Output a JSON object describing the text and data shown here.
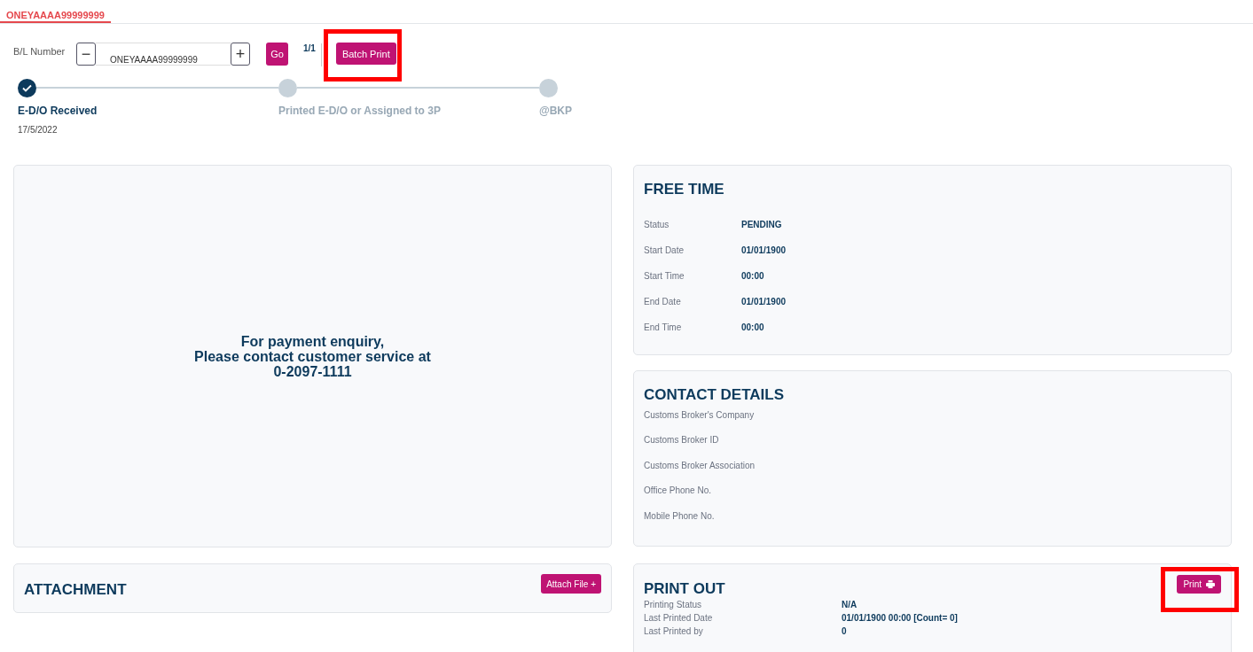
{
  "tabs": [
    {
      "label": "ONEYAAAA99999999",
      "selected": true
    }
  ],
  "search": {
    "label": "B/L Number",
    "minus": "−",
    "value": "ONEYAAAA99999999",
    "plus": "+",
    "go": "Go",
    "page": "1/1",
    "batch_print": "Batch Print",
    "highlighted": true
  },
  "steps": [
    {
      "label": "E-D/O Received",
      "date": "17/5/2022",
      "done": true
    },
    {
      "label": "Printed E-D/O or Assigned to 3P",
      "done": false
    },
    {
      "label": "@BKP",
      "done": false
    }
  ],
  "payment_notice": [
    "For payment enquiry,",
    "Please contact customer service at",
    "0-2097-1111"
  ],
  "free_time": {
    "title": "FREE TIME",
    "rows": [
      {
        "label": "Status",
        "value": "PENDING"
      },
      {
        "label": "Start Date",
        "value": "01/01/1900"
      },
      {
        "label": "Start Time",
        "value": "00:00"
      },
      {
        "label": "End Date",
        "value": "01/01/1900"
      },
      {
        "label": "End Time",
        "value": "00:00"
      }
    ]
  },
  "contact_details": {
    "title": "CONTACT DETAILS",
    "rows": [
      {
        "label": "Customs Broker's Company"
      },
      {
        "label": "Customs Broker ID"
      },
      {
        "label": "Customs Broker Association"
      },
      {
        "label": "Office Phone No."
      },
      {
        "label": "Mobile Phone No."
      }
    ]
  },
  "attachment": {
    "title": "ATTACHMENT",
    "button": "Attach File +"
  },
  "print_out": {
    "title": "PRINT OUT",
    "button": "Print",
    "highlighted": true,
    "rows": [
      {
        "label": "Printing Status",
        "value": "N/A"
      },
      {
        "label": "Last Printed Date",
        "value": "01/01/1900 00:00 [Count= 0]"
      },
      {
        "label": "Last Printed by",
        "value": "0"
      }
    ]
  }
}
